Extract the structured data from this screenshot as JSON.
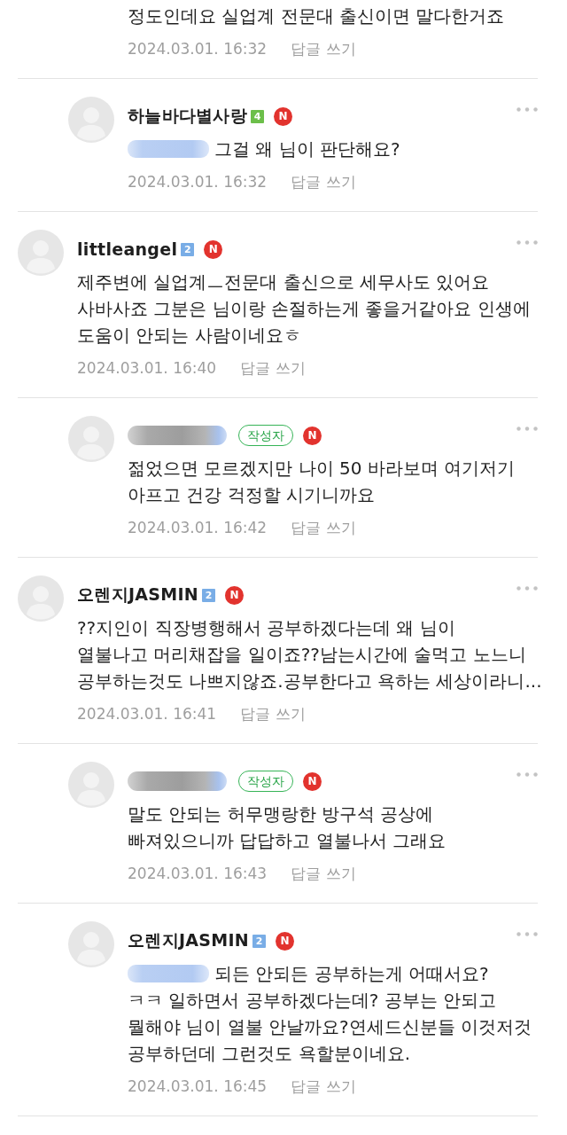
{
  "partial_comment": {
    "text": "정도인데요 실업계 전문대 출신이면 말다한거죠",
    "date": "2024.03.01. 16:32",
    "reply_link": "답글 쓰기"
  },
  "comments": [
    {
      "kind": "reply",
      "name_blurred": false,
      "name": "하늘바다별사랑",
      "level_badge": {
        "text": "4",
        "color": "#6cbf4a"
      },
      "new_badge": "N",
      "mention_blurred": true,
      "text": "그걸 왜 님이 판단해요?",
      "date": "2024.03.01. 16:32",
      "reply_link": "답글 쓰기"
    },
    {
      "kind": "comment",
      "name_blurred": false,
      "name": "littleangel",
      "level_badge": {
        "text": "2",
        "color": "#79ade6"
      },
      "new_badge": "N",
      "mention_blurred": false,
      "text": "제주변에 실업계ㅡ전문대 출신으로 세무사도 있어요\n사바사죠 그분은 님이랑 손절하는게 좋을거같아요 인생에\n도움이 안되는 사람이네요ㅎ",
      "date": "2024.03.01. 16:40",
      "reply_link": "답글 쓰기"
    },
    {
      "kind": "reply",
      "name_blurred": true,
      "author_tag": "작성자",
      "new_badge": "N",
      "mention_blurred": false,
      "text": "젊었으면 모르겠지만 나이 50 바라보며 여기저기\n아프고 건강 걱정할 시기니까요",
      "date": "2024.03.01. 16:42",
      "reply_link": "답글 쓰기"
    },
    {
      "kind": "comment",
      "name_blurred": false,
      "name": "오렌지JASMIN",
      "level_badge": {
        "text": "2",
        "color": "#79ade6"
      },
      "new_badge": "N",
      "mention_blurred": false,
      "text": "??지인이 직장병행해서 공부하겠다는데 왜 님이\n열불나고 머리채잡을 일이죠??남는시간에 술먹고 노느니\n공부하는것도 나쁘지않죠.공부한다고 욕하는 세상이라니...",
      "date": "2024.03.01. 16:41",
      "reply_link": "답글 쓰기"
    },
    {
      "kind": "reply",
      "name_blurred": true,
      "author_tag": "작성자",
      "new_badge": "N",
      "mention_blurred": false,
      "text": "말도 안되는 허무맹랑한 방구석 공상에\n빠져있으니까 답답하고 열불나서 그래요",
      "date": "2024.03.01. 16:43",
      "reply_link": "답글 쓰기"
    },
    {
      "kind": "reply",
      "name_blurred": false,
      "name": "오렌지JASMIN",
      "level_badge": {
        "text": "2",
        "color": "#79ade6"
      },
      "new_badge": "N",
      "mention_blurred": true,
      "text": "되든 안되든 공부하는게 어때서요?\nㅋㅋ 일하면서 공부하겠다는데? 공부는 안되고\n뭘해야 님이 열불 안날까요?연세드신분들 이것저것\n공부하던데 그런것도 욕할분이네요.",
      "date": "2024.03.01. 16:45",
      "reply_link": "답글 쓰기"
    }
  ]
}
